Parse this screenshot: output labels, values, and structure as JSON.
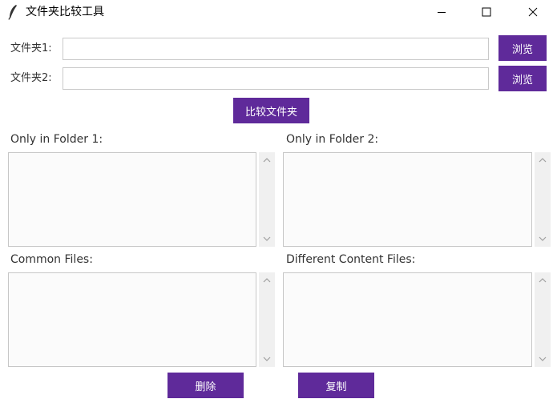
{
  "window": {
    "title": "文件夹比较工具",
    "icon": "feather-icon"
  },
  "folders": [
    {
      "label": "文件夹1:",
      "value": "",
      "browse_label": "浏览"
    },
    {
      "label": "文件夹2:",
      "value": "",
      "browse_label": "浏览"
    }
  ],
  "compare_button": "比较文件夹",
  "panels": {
    "only_in_1": {
      "label": "Only in Folder 1:",
      "items": []
    },
    "only_in_2": {
      "label": "Only in Folder 2:",
      "items": []
    },
    "common": {
      "label": "Common Files:",
      "items": []
    },
    "different": {
      "label": "Different Content Files:",
      "items": []
    }
  },
  "actions": {
    "delete_label": "删除",
    "copy_label": "复制"
  },
  "colors": {
    "accent": "#5f2a9a"
  }
}
